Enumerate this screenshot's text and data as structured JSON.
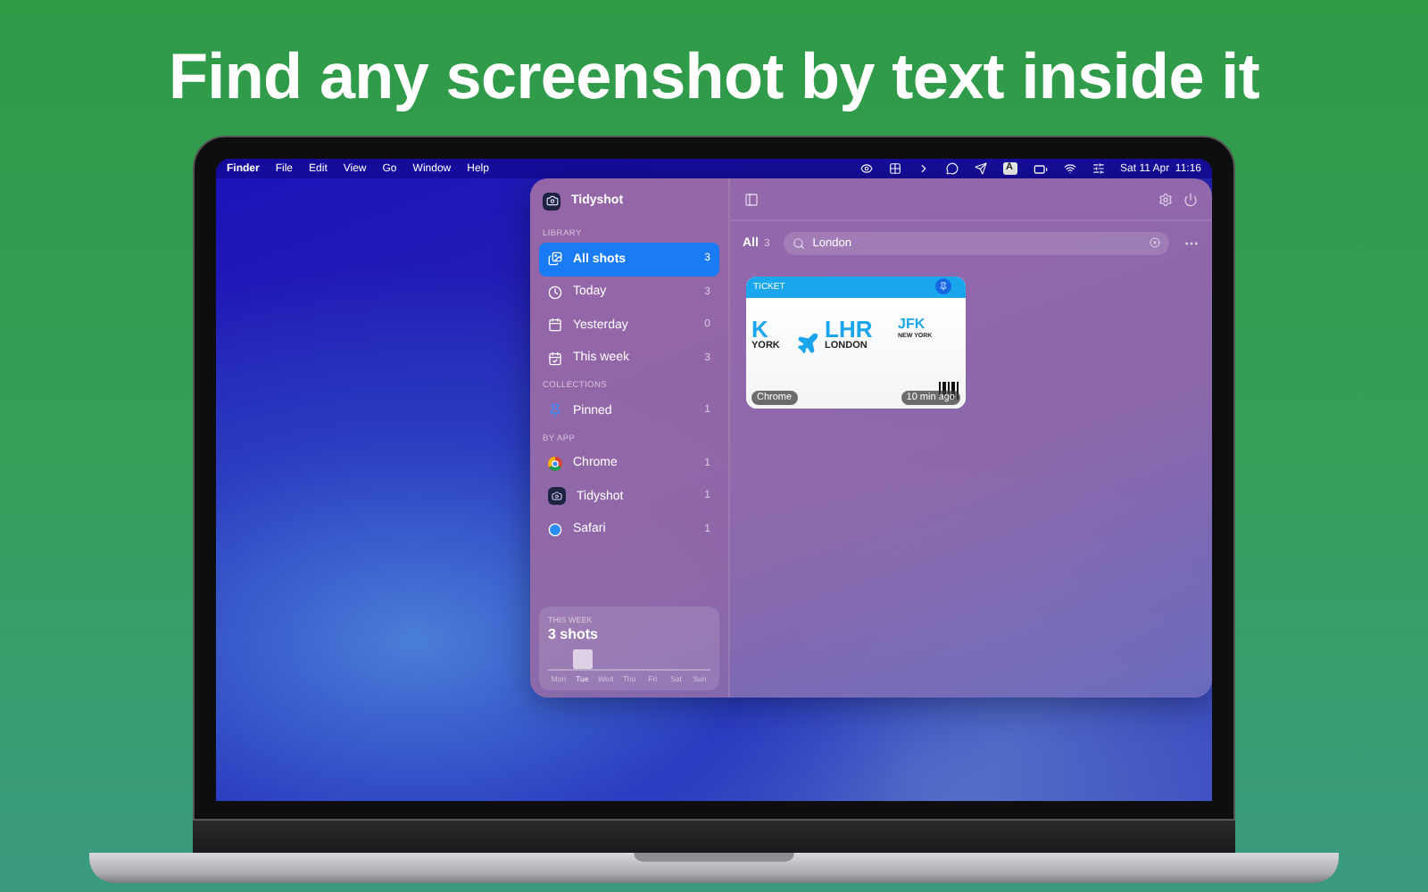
{
  "headline": "Find any screenshot by text inside it",
  "menubar": {
    "app": "Finder",
    "items": [
      "File",
      "Edit",
      "View",
      "Go",
      "Window",
      "Help"
    ],
    "input_source": "A",
    "clock": "Sat 11 Apr  11:16"
  },
  "app": {
    "title": "Tidyshot",
    "sections": [
      {
        "heading": "LIBRARY",
        "items": [
          {
            "kind": "photos",
            "label": "All shots",
            "count": "3",
            "selected": true
          },
          {
            "kind": "clock",
            "label": "Today",
            "count": "3",
            "selected": false
          },
          {
            "kind": "calendar",
            "label": "Yesterday",
            "count": "0",
            "selected": false
          },
          {
            "kind": "week",
            "label": "This week",
            "count": "3",
            "selected": false
          }
        ]
      },
      {
        "heading": "COLLECTIONS",
        "items": [
          {
            "kind": "pin",
            "label": "Pinned",
            "count": "1",
            "selected": false
          }
        ]
      },
      {
        "heading": "BY APP",
        "items": [
          {
            "kind": "chrome",
            "label": "Chrome",
            "count": "1",
            "selected": false
          },
          {
            "kind": "tidyshot",
            "label": "Tidyshot",
            "count": "1",
            "selected": false
          },
          {
            "kind": "safari",
            "label": "Safari",
            "count": "1",
            "selected": false
          }
        ]
      }
    ],
    "stats": {
      "heading": "THIS WEEK",
      "value": "3 shots",
      "days": [
        {
          "label": "Mon",
          "active": false
        },
        {
          "label": "Tue",
          "active": true
        },
        {
          "label": "Wed",
          "active": false
        },
        {
          "label": "Thu",
          "active": false
        },
        {
          "label": "Fri",
          "active": false
        },
        {
          "label": "Sat",
          "active": false
        },
        {
          "label": "Sun",
          "active": false
        }
      ]
    },
    "filter": {
      "label": "All",
      "count": "3"
    },
    "search": {
      "value": "London"
    },
    "shots": [
      {
        "app": "Chrome",
        "time": "10 min ago",
        "pinned": true,
        "ticket": {
          "header": "TICKET",
          "from_code": "K",
          "from_city": "YORK",
          "to_code": "LHR",
          "to_city": "LONDON",
          "stub_code": "JFK",
          "stub_city": "NEW YORK"
        }
      }
    ]
  }
}
